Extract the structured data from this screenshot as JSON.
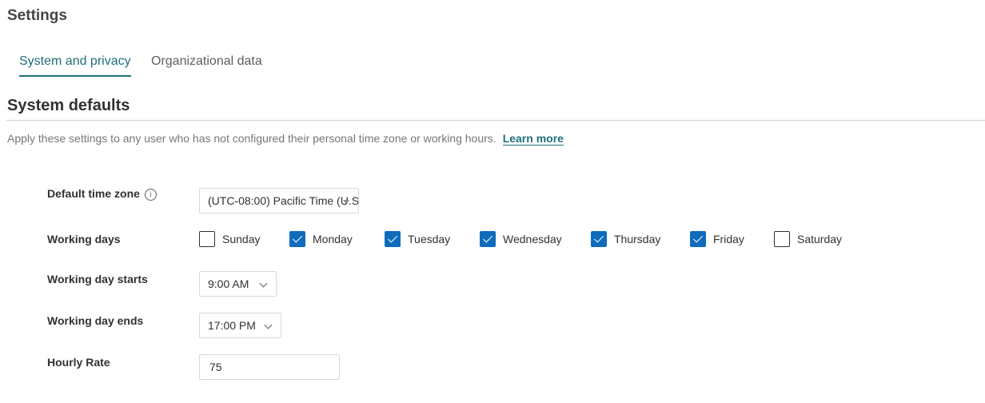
{
  "page": {
    "title": "Settings"
  },
  "tabs": [
    {
      "label": "System and privacy",
      "active": true
    },
    {
      "label": "Organizational data",
      "active": false
    }
  ],
  "section": {
    "title": "System defaults",
    "description": "Apply these settings to any user who has not configured their personal time zone or working hours.",
    "learn_more": "Learn more"
  },
  "fields": {
    "time_zone": {
      "label": "Default time zone",
      "value": "(UTC-08:00) Pacific Time (U.S."
    },
    "working_days": {
      "label": "Working days",
      "days": [
        {
          "label": "Sunday",
          "checked": false
        },
        {
          "label": "Monday",
          "checked": true
        },
        {
          "label": "Tuesday",
          "checked": true
        },
        {
          "label": "Wednesday",
          "checked": true
        },
        {
          "label": "Thursday",
          "checked": true
        },
        {
          "label": "Friday",
          "checked": true
        },
        {
          "label": "Saturday",
          "checked": false
        }
      ]
    },
    "day_starts": {
      "label": "Working day starts",
      "value": "9:00 AM"
    },
    "day_ends": {
      "label": "Working day ends",
      "value": "17:00 PM"
    },
    "hourly_rate": {
      "label": "Hourly Rate",
      "value": "75"
    }
  },
  "colors": {
    "accent": "#1f6f7a",
    "checkbox": "#0f6cbd"
  },
  "icons": {
    "info": "info-icon",
    "dropdown": "chevron-down-icon"
  }
}
